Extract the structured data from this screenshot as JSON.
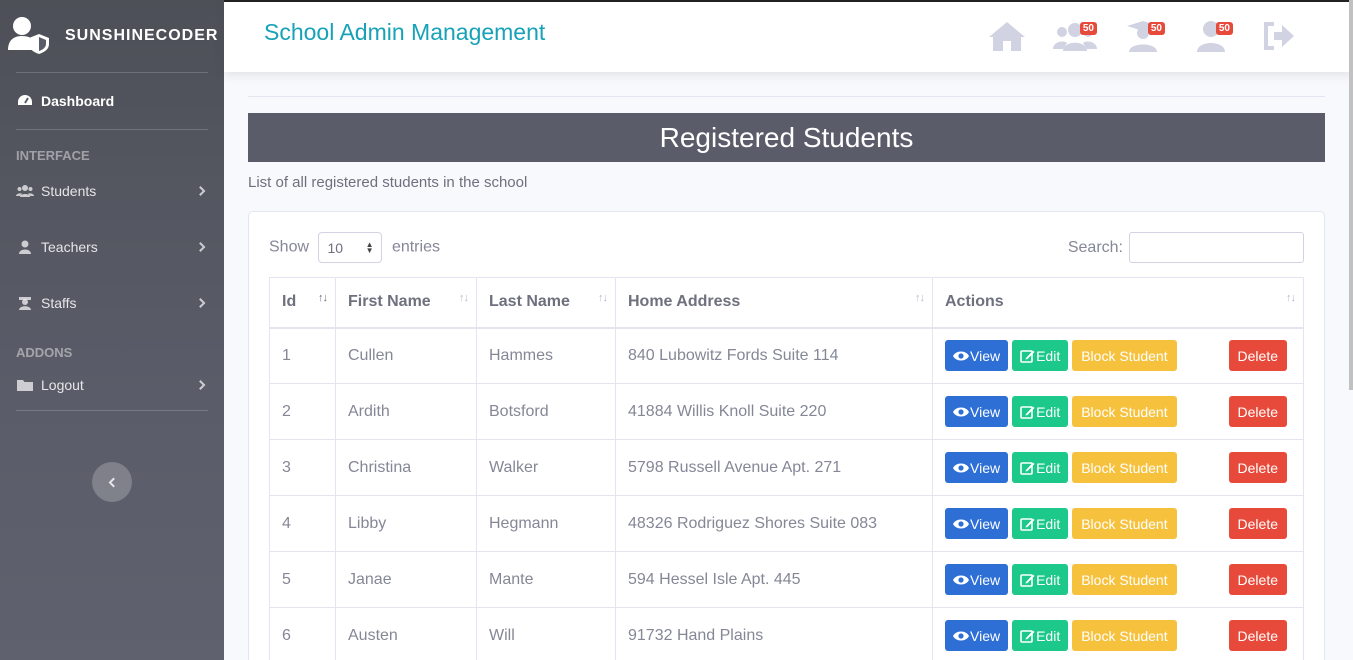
{
  "brand": {
    "name": "SUNSHINECODER"
  },
  "sidebar": {
    "dashboard": "Dashboard",
    "interface_heading": "INTERFACE",
    "students": "Students",
    "teachers": "Teachers",
    "staffs": "Staffs",
    "addons_heading": "ADDONS",
    "logout": "Logout"
  },
  "topbar": {
    "title": "School Admin Management",
    "badges": {
      "students": "50",
      "teachers": "50",
      "staffs": "50"
    }
  },
  "page": {
    "banner": "Registered Students",
    "subtitle": "List of all registered students in the school"
  },
  "table_controls": {
    "show_label": "Show",
    "entries_value": "10",
    "entries_label": "entries",
    "search_label": "Search:"
  },
  "table": {
    "columns": [
      "Id",
      "First Name",
      "Last Name",
      "Home Address",
      "Actions"
    ],
    "rows": [
      {
        "id": "1",
        "first": "Cullen",
        "last": "Hammes",
        "address": "840 Lubowitz Fords Suite 114"
      },
      {
        "id": "2",
        "first": "Ardith",
        "last": "Botsford",
        "address": "41884 Willis Knoll Suite 220"
      },
      {
        "id": "3",
        "first": "Christina",
        "last": "Walker",
        "address": "5798 Russell Avenue Apt. 271"
      },
      {
        "id": "4",
        "first": "Libby",
        "last": "Hegmann",
        "address": "48326 Rodriguez Shores Suite 083"
      },
      {
        "id": "5",
        "first": "Janae",
        "last": "Mante",
        "address": "594 Hessel Isle Apt. 445"
      },
      {
        "id": "6",
        "first": "Austen",
        "last": "Will",
        "address": "91732 Hand Plains"
      }
    ],
    "buttons": {
      "view": "View",
      "edit": "Edit",
      "block": "Block Student",
      "delete": "Delete"
    }
  },
  "colors": {
    "accent": "#17a2b8",
    "sidebar": "#5a5c69",
    "view": "#2e6fd6",
    "edit": "#1cc88a",
    "block": "#f6c23e",
    "delete": "#e74a3b"
  }
}
